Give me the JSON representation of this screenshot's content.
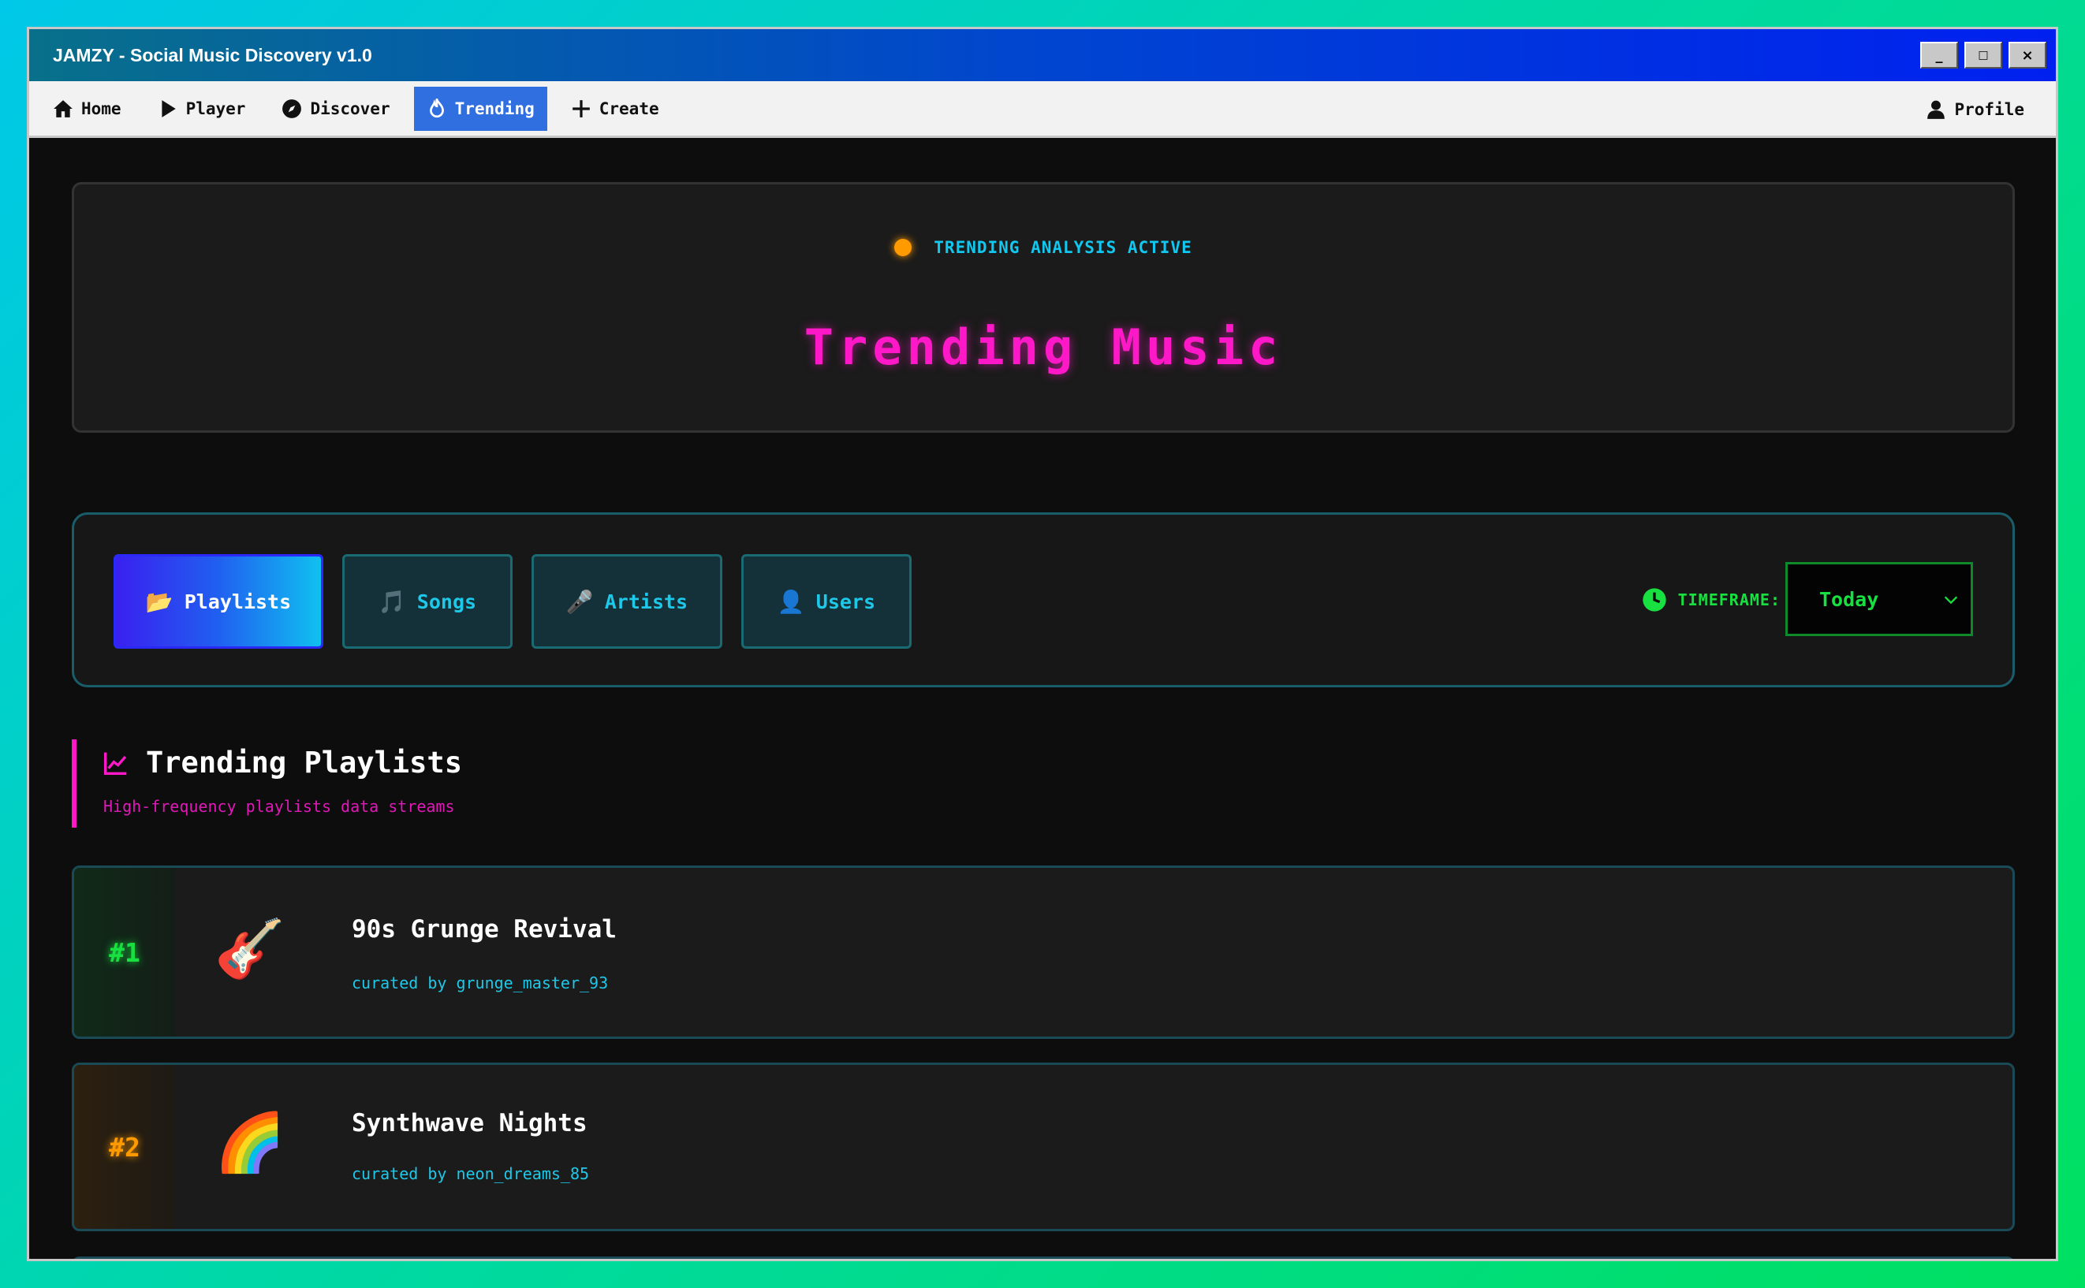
{
  "window": {
    "title": "JAMZY - Social Music Discovery v1.0",
    "buttons": {
      "minimize": "_",
      "maximize": "□",
      "close": "×"
    }
  },
  "nav": {
    "items": [
      {
        "label": "Home",
        "icon": "home-icon"
      },
      {
        "label": "Player",
        "icon": "play-icon"
      },
      {
        "label": "Discover",
        "icon": "compass-icon"
      },
      {
        "label": "Trending",
        "icon": "flame-icon",
        "active": true
      },
      {
        "label": "Create",
        "icon": "plus-icon"
      }
    ],
    "profile": {
      "label": "Profile",
      "icon": "user-icon"
    }
  },
  "hero": {
    "status": "TRENDING ANALYSIS ACTIVE",
    "title": "Trending Music"
  },
  "tabs": [
    {
      "emoji": "📂",
      "label": "Playlists",
      "active": true
    },
    {
      "emoji": "🎵",
      "label": "Songs"
    },
    {
      "emoji": "🎤",
      "label": "Artists"
    },
    {
      "emoji": "👤",
      "label": "Users"
    }
  ],
  "timeframe": {
    "label": "TIMEFRAME:",
    "selected": "Today"
  },
  "section": {
    "title": "Trending Playlists",
    "subtitle": "High-frequency playlists data streams"
  },
  "playlists": [
    {
      "rank": "#1",
      "emoji": "🎸",
      "name": "90s Grunge Revival",
      "curator": "curated by grunge_master_93",
      "rank_color": "#18e040"
    },
    {
      "rank": "#2",
      "emoji": "🌈",
      "name": "Synthwave Nights",
      "curator": "curated by neon_dreams_85",
      "rank_color": "#ff9a00"
    }
  ],
  "colors": {
    "accent_magenta": "#ff18c8",
    "accent_cyan": "#1ec8e8",
    "accent_green": "#18e040",
    "accent_orange": "#ff9a00",
    "nav_active": "#2f6fe0"
  }
}
